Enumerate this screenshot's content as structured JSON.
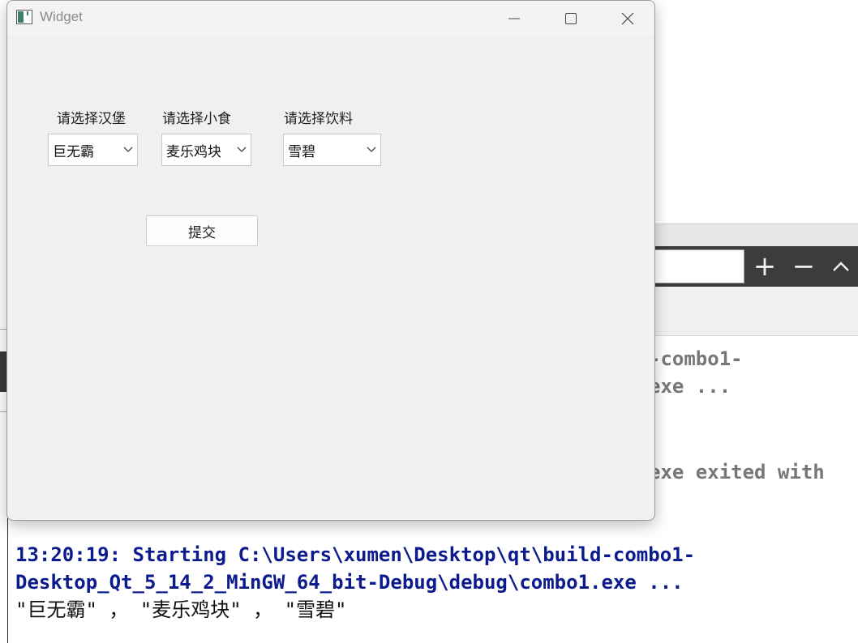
{
  "window": {
    "title": "Widget",
    "icons": {
      "app": "app-window-icon",
      "minimize": "minimize-icon",
      "maximize": "maximize-icon",
      "close": "close-icon"
    }
  },
  "form": {
    "burger": {
      "label": "请选择汉堡",
      "selected": "巨无霸"
    },
    "snack": {
      "label": "请选择小食",
      "selected": "麦乐鸡块"
    },
    "drink": {
      "label": "请选择饮料",
      "selected": "雪碧"
    },
    "submit_label": "提交"
  },
  "ide": {
    "find_toolbar_icons": [
      "plus-icon",
      "minus-icon",
      "chevron-up-icon"
    ],
    "output_fragments": [
      "-combo1-",
      "exe ...",
      "exe exited with"
    ],
    "output_line1": "13:20:19: Starting C:\\Users\\xumen\\Desktop\\qt\\build-combo1-",
    "output_line2": "Desktop_Qt_5_14_2_MinGW_64_bit-Debug\\debug\\combo1.exe ...",
    "output_line3": "\"巨无霸\" ， \"麦乐鸡块\" ， \"雪碧\""
  },
  "colors": {
    "output_blue": "#0b1a8c",
    "output_gray": "#777777",
    "window_bg": "#f0f0f0",
    "toolbar_dark": "#3c3c3c"
  }
}
